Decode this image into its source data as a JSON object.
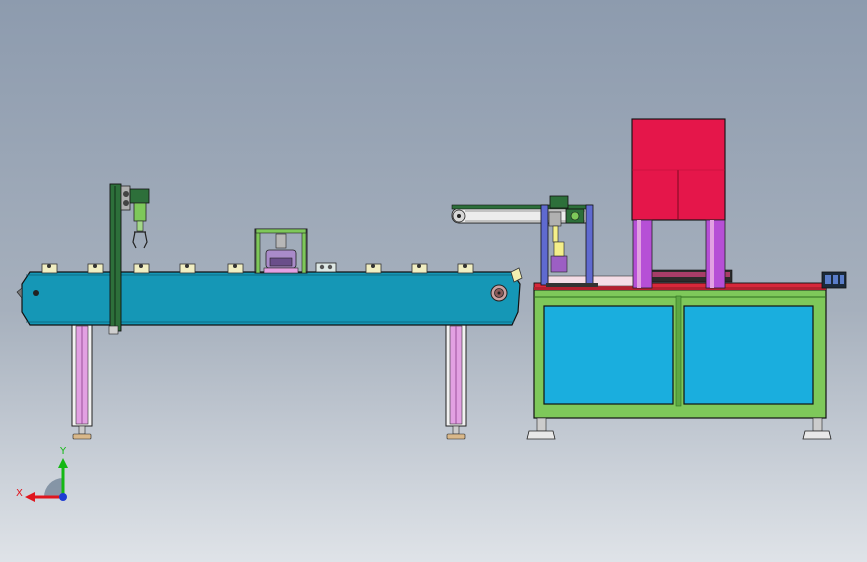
{
  "triad": {
    "x_label": "X",
    "y_label": "Y",
    "x_color": "#e0161e",
    "y_color": "#14b814",
    "z_color": "#1e3cd2"
  },
  "colors": {
    "conveyor_belt": "#1597b6",
    "legs": "#e2a0e2",
    "frame": "#7ec85a",
    "panels": "#1aaede",
    "hood": "#e5164a",
    "columns": "#b64fd6",
    "gantry": "#5f6ad0",
    "top_plate": "#d7283a"
  },
  "views": {
    "background": "gradient-gray-blue"
  }
}
